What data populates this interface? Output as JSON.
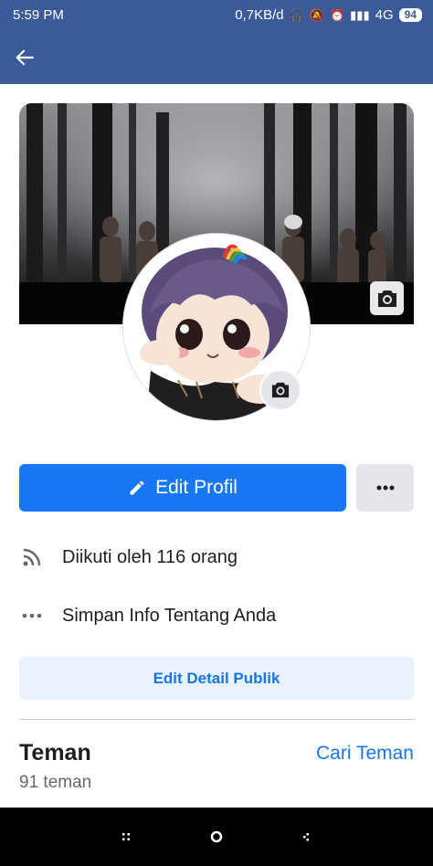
{
  "status_bar": {
    "time": "5:59 PM",
    "net_speed": "0,7KB/d",
    "network": "4G",
    "battery": "94"
  },
  "profile": {
    "edit_profile_label": "Edit Profil",
    "followed_by": "Diikuti oleh 116 orang",
    "save_info": "Simpan Info Tentang Anda",
    "edit_public_details": "Edit Detail Publik"
  },
  "friends": {
    "title": "Teman",
    "find_link": "Cari Teman",
    "count": "91 teman"
  },
  "icons": {
    "back": "back-arrow-icon",
    "camera": "camera-icon",
    "more": "more-horizontal-icon",
    "pencil": "pencil-icon",
    "rss": "rss-feed-icon"
  },
  "colors": {
    "header": "#3b5a99",
    "primary": "#1877f2",
    "light_button": "#e4e6eb",
    "public_button_bg": "#e7f3ff"
  }
}
